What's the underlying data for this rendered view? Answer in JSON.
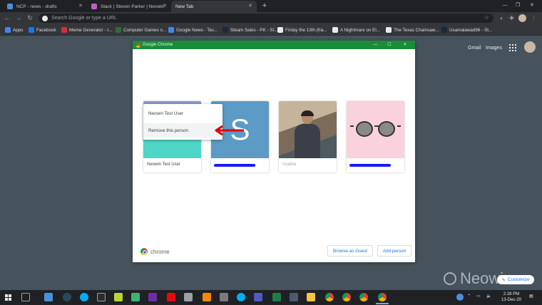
{
  "browser": {
    "tabs": [
      {
        "label": "NCP - news - drafts",
        "active": false,
        "color": "#4a90d9"
      },
      {
        "label": "Slack | Steven Parker | Neowin",
        "active": false,
        "color": "#c25ecb"
      },
      {
        "label": "New Tab",
        "active": true,
        "color": ""
      }
    ],
    "omnibox_placeholder": "Search Google or type a URL",
    "bookmarks": [
      {
        "label": "Apps",
        "color": "#4285f4"
      },
      {
        "label": "Facebook",
        "color": "#1877f2"
      },
      {
        "label": "Meme Generator - I...",
        "color": "#d23030"
      },
      {
        "label": "Computer Games o...",
        "color": "#2f6b3b"
      },
      {
        "label": "Google News - Tec...",
        "color": "#4285f4"
      },
      {
        "label": "Steam Sales - PK - St...",
        "color": "#1b2838"
      },
      {
        "label": "Friday the 13th (fra...",
        "color": "#9aa0a6"
      },
      {
        "label": "A Nightmare on El...",
        "color": "#9aa0a6"
      },
      {
        "label": "The Texas Chainsaw...",
        "color": "#9aa0a6"
      },
      {
        "label": "Usamalawad96 - St...",
        "color": "#1b2838"
      }
    ]
  },
  "ntp": {
    "gmail": "Gmail",
    "images": "Images",
    "customize": "Customize",
    "watermark": "Neowin"
  },
  "picker": {
    "window_title": "Google Chrome",
    "profiles": [
      {
        "name": "Neowin Test User"
      },
      {
        "name": "",
        "letter": "S"
      },
      {
        "name": "Usama"
      },
      {
        "name": ""
      }
    ],
    "context_menu": {
      "header": "Neowin Test User",
      "remove": "Remove this person"
    },
    "brand": "chrome",
    "browse_as_guest": "Browse as Guest",
    "add_person": "Add person"
  },
  "taskbar": {
    "time": "2:28 PM",
    "date": "13-Dec-20"
  },
  "colors": {
    "accent": "#1a73e8",
    "picker_titlebar": "#1a8c3a",
    "arrow": "#e00000"
  }
}
